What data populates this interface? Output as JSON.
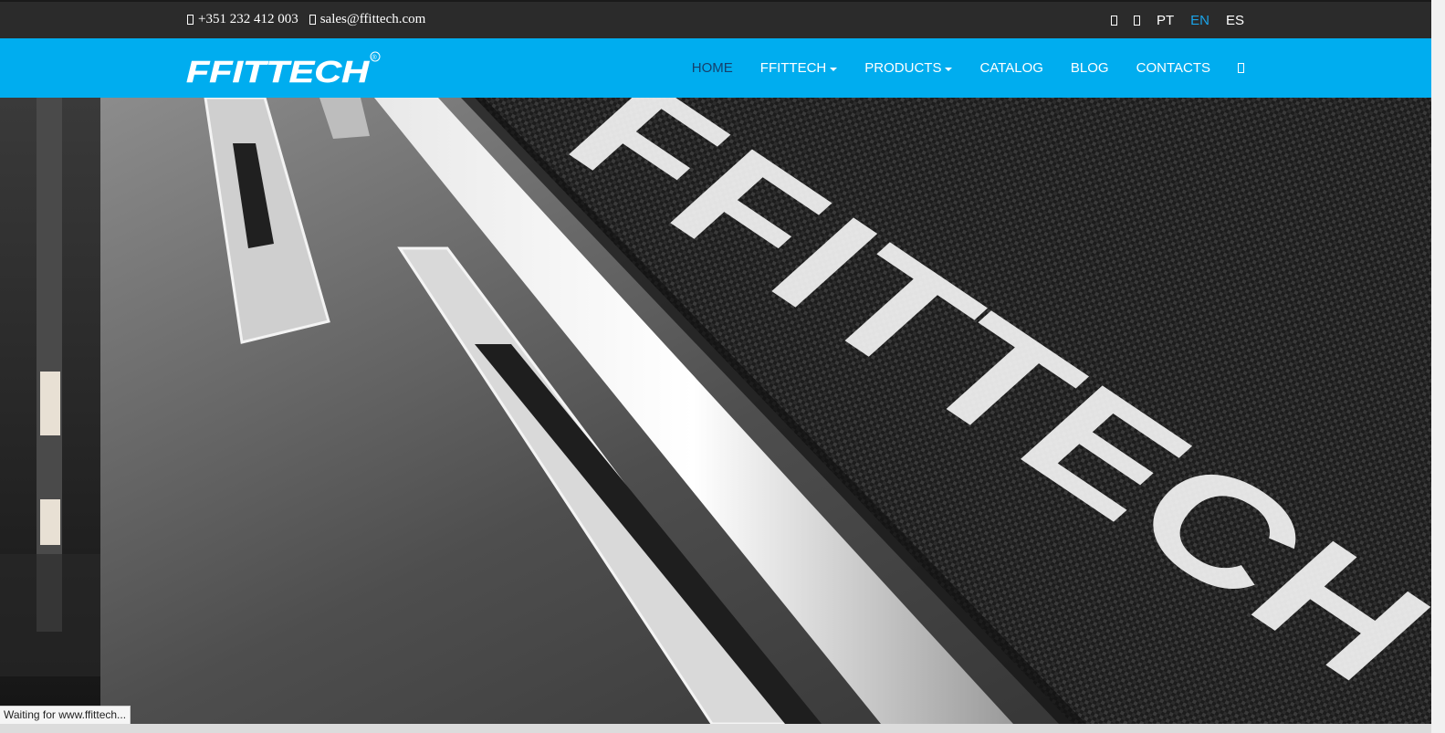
{
  "topbar": {
    "phone": "+351 232 412 003",
    "email": "sales@ffittech.com",
    "phone_icon": "phone-icon",
    "email_icon": "envelope-icon",
    "social_icons": [
      "facebook-icon",
      "instagram-icon"
    ],
    "languages": [
      {
        "label": "PT",
        "active": false
      },
      {
        "label": "EN",
        "active": true
      },
      {
        "label": "ES",
        "active": false
      }
    ]
  },
  "navbar": {
    "logo_text": "FFITTECH",
    "logo_mark": "®",
    "items": [
      {
        "label": "HOME",
        "active": true,
        "dropdown": false
      },
      {
        "label": "FFITTECH",
        "active": false,
        "dropdown": true
      },
      {
        "label": "PRODUCTS",
        "active": false,
        "dropdown": true
      },
      {
        "label": "CATALOG",
        "active": false,
        "dropdown": false
      },
      {
        "label": "BLOG",
        "active": false,
        "dropdown": false
      },
      {
        "label": "CONTACTS",
        "active": false,
        "dropdown": false
      }
    ],
    "search_icon": "search-icon"
  },
  "hero": {
    "belt_text": "FFITTECH"
  },
  "status_bar": {
    "text": "Waiting for www.ffittech..."
  },
  "colors": {
    "topbar_bg": "#2b2b2b",
    "navbar_bg": "#00adef",
    "active_nav": "#16406b",
    "active_lang": "#1aa3e8"
  }
}
